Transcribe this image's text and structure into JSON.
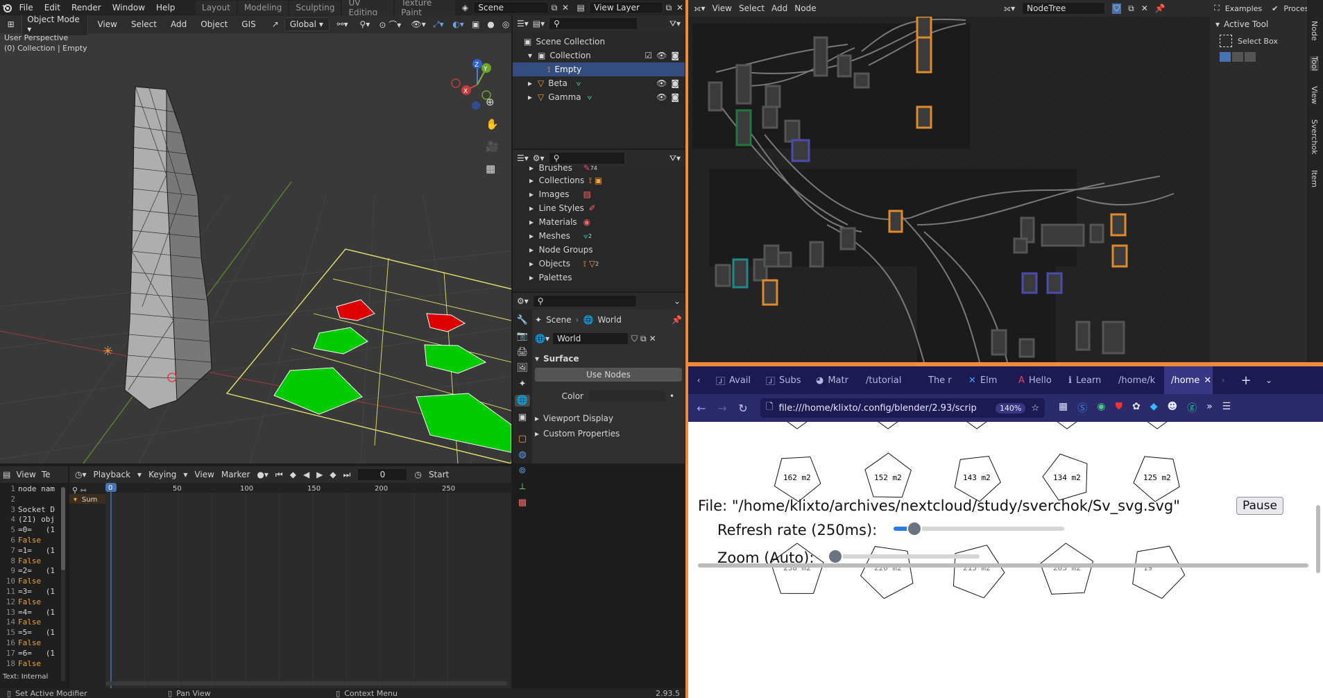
{
  "topbar": {
    "menus": [
      "File",
      "Edit",
      "Render",
      "Window",
      "Help"
    ],
    "workspaces": [
      "Layout",
      "Modeling",
      "Sculpting",
      "UV Editing",
      "Texture Paint"
    ],
    "scene": "Scene",
    "view_layer": "View Layer"
  },
  "viewport": {
    "mode": "Object Mode",
    "menus": [
      "View",
      "Select",
      "Add",
      "Object",
      "GIS"
    ],
    "orientation": "Global",
    "info_line1": "User Perspective",
    "info_line2": "(0) Collection | Empty",
    "gizmo": {
      "x": "X",
      "y": "Y",
      "z": "Z"
    }
  },
  "outliner": {
    "root": "Scene Collection",
    "items": [
      {
        "label": "Collection",
        "level": 1
      },
      {
        "label": "Empty",
        "level": 2,
        "selected": true
      },
      {
        "label": "Beta",
        "level": 1
      },
      {
        "label": "Gamma",
        "level": 1
      }
    ]
  },
  "databrowser": {
    "items": [
      "Brushes",
      "Collections",
      "Images",
      "Line Styles",
      "Materials",
      "Meshes",
      "Node Groups",
      "Objects",
      "Palettes"
    ],
    "brush_count": "74",
    "mesh_count": "2",
    "object_count": "2"
  },
  "properties": {
    "breadcrumb_scene": "Scene",
    "breadcrumb_world": "World",
    "world_name": "World",
    "surface_panel": "Surface",
    "use_nodes": "Use Nodes",
    "color_label": "Color",
    "viewport_display": "Viewport Display",
    "custom_properties": "Custom Properties"
  },
  "texteditor": {
    "menus": [
      "View",
      "Te"
    ],
    "lines": [
      {
        "n": "1",
        "t": "node nam"
      },
      {
        "n": "2",
        "t": ""
      },
      {
        "n": "3",
        "t": "Socket D"
      },
      {
        "n": "4",
        "t": "(21) obj"
      },
      {
        "n": "5",
        "t": "=0=   (1"
      },
      {
        "n": "6",
        "t": "False"
      },
      {
        "n": "7",
        "t": "=1=   (1"
      },
      {
        "n": "8",
        "t": "False"
      },
      {
        "n": "9",
        "t": "=2=   (1"
      },
      {
        "n": "10",
        "t": "False"
      },
      {
        "n": "11",
        "t": "=3=   (1"
      },
      {
        "n": "12",
        "t": "False"
      },
      {
        "n": "13",
        "t": "=4=   (1"
      },
      {
        "n": "14",
        "t": "False"
      },
      {
        "n": "15",
        "t": "=5=   (1"
      },
      {
        "n": "16",
        "t": "False"
      },
      {
        "n": "17",
        "t": "=6=   (1"
      },
      {
        "n": "18",
        "t": "False"
      }
    ],
    "footer": "Text: Internal"
  },
  "timeline": {
    "menus": [
      "Playback",
      "Keying",
      "View",
      "Marker"
    ],
    "current_frame": "0",
    "start_label": "Start",
    "ticks": [
      "0",
      "50",
      "100",
      "150",
      "200",
      "250"
    ],
    "summary": "Sum"
  },
  "status": {
    "left": "Set Active Modifier",
    "mid": "Pan View",
    "right": "Context Menu",
    "version": "2.93.5"
  },
  "nodeeditor": {
    "menus": [
      "View",
      "Select",
      "Add",
      "Node"
    ],
    "tree_name": "NodeTree",
    "examples": "Examples",
    "processing": "Processing"
  },
  "sidebar": {
    "panel": "Active Tool",
    "tool": "Select Box",
    "tabs": [
      "Node",
      "Tool",
      "View",
      "Sverchok",
      "Item"
    ]
  },
  "browser": {
    "tabs": [
      "Avail",
      "Subs",
      "Matr",
      "/tutorial",
      "The r",
      "Elm",
      "Hello",
      "Learn",
      "/home/k",
      "/home"
    ],
    "url": "file:///home/klixto/.config/blender/2.93/scrip",
    "zoom": "140%",
    "pentagons_row1": [
      "162 m2",
      "152 m2",
      "143 m2",
      "134 m2",
      "125 m2"
    ],
    "pentagons_row2": [
      "238 m2",
      "220 m2",
      "213 m2",
      "203 m2",
      "19"
    ],
    "file_line": "File: \"/home/klixto/archives/nextcloud/study/sverchok/Sv_svg.svg\"",
    "pause": "Pause",
    "refresh_label": "Refresh rate (250ms):",
    "zoom_label": "Zoom (Auto):",
    "refresh_value": 0.12,
    "zoom_value": 0.0
  },
  "colors": {
    "accent": "#4772b3",
    "selected_row": "#334d80",
    "browser_tabbar": "#1d1a53",
    "plane_green": "#00cc00",
    "plane_red": "#dd0000"
  }
}
